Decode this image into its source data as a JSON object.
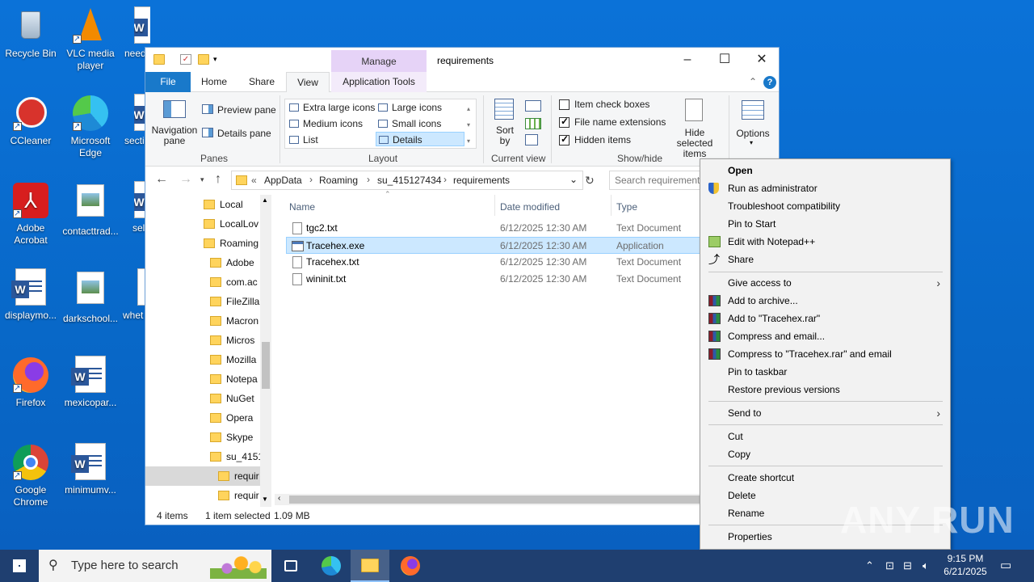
{
  "desktop": {
    "icons": [
      {
        "label": "Recycle Bin",
        "icon": "recycle-bin-icon"
      },
      {
        "label": "VLC media player",
        "icon": "vlc-icon"
      },
      {
        "label": "need",
        "icon": "word-doc-icon"
      },
      {
        "label": "CCleaner",
        "icon": "ccleaner-icon"
      },
      {
        "label": "Microsoft Edge",
        "icon": "edge-icon"
      },
      {
        "label": "secti",
        "icon": "word-doc-icon"
      },
      {
        "label": "Adobe Acrobat",
        "icon": "acrobat-icon"
      },
      {
        "label": "contacttrad...",
        "icon": "image-file-icon"
      },
      {
        "label": "sel",
        "icon": "word-doc-icon"
      },
      {
        "label": "displaymo...",
        "icon": "word-doc-icon"
      },
      {
        "label": "darkschool...",
        "icon": "image-file-icon"
      },
      {
        "label": "whet",
        "icon": "word-doc-icon"
      },
      {
        "label": "Firefox",
        "icon": "firefox-icon"
      },
      {
        "label": "mexicopar...",
        "icon": "word-doc-icon"
      },
      {
        "label": "Google Chrome",
        "icon": "chrome-icon"
      },
      {
        "label": "minimumv...",
        "icon": "word-doc-icon"
      }
    ]
  },
  "window": {
    "title": "requirements",
    "manage_label": "Manage",
    "tabs": {
      "file": "File",
      "home": "Home",
      "share": "Share",
      "view": "View",
      "app_tools": "Application Tools"
    },
    "ribbon": {
      "panes": {
        "nav_pane": "Navigation pane",
        "preview_pane": "Preview pane",
        "details_pane": "Details pane",
        "group": "Panes"
      },
      "layout": {
        "extra_large": "Extra large icons",
        "large": "Large icons",
        "medium": "Medium icons",
        "small": "Small icons",
        "list": "List",
        "details": "Details",
        "group": "Layout"
      },
      "current_view": {
        "sort_by": "Sort by",
        "group": "Current view"
      },
      "show_hide": {
        "item_check_boxes": "Item check boxes",
        "file_name_extensions": "File name extensions",
        "hidden_items": "Hidden items",
        "hide_selected": "Hide selected items",
        "group": "Show/hide"
      },
      "options": "Options"
    },
    "address": {
      "crumbs": [
        "AppData",
        "Roaming",
        "su_415127434",
        "requirements"
      ],
      "search_placeholder": "Search requirements"
    },
    "nav_pane": [
      "Local",
      "LocalLov",
      "Roaming",
      "Adobe",
      "com.ac",
      "FileZilla",
      "Macron",
      "Micros",
      "Mozilla",
      "Notepa",
      "NuGet",
      "Opera",
      "Skype",
      "su_4151",
      "requir",
      "requir"
    ],
    "columns": {
      "name": "Name",
      "date": "Date modified",
      "type": "Type"
    },
    "files": [
      {
        "name": "tgc2.txt",
        "date": "6/12/2025 12:30 AM",
        "type": "Text Document"
      },
      {
        "name": "Tracehex.exe",
        "date": "6/12/2025 12:30 AM",
        "type": "Application"
      },
      {
        "name": "Tracehex.txt",
        "date": "6/12/2025 12:30 AM",
        "type": "Text Document"
      },
      {
        "name": "wininit.txt",
        "date": "6/12/2025 12:30 AM",
        "type": "Text Document"
      }
    ],
    "status": {
      "count": "4 items",
      "selected": "1 item selected",
      "size": "1.09 MB"
    }
  },
  "context_menu": {
    "open": "Open",
    "run_as_admin": "Run as administrator",
    "troubleshoot": "Troubleshoot compatibility",
    "pin_start": "Pin to Start",
    "edit_npp": "Edit with Notepad++",
    "share": "Share",
    "give_access": "Give access to",
    "add_archive": "Add to archive...",
    "add_rar": "Add to \"Tracehex.rar\"",
    "compress_email": "Compress and email...",
    "compress_rar_email": "Compress to \"Tracehex.rar\" and email",
    "pin_taskbar": "Pin to taskbar",
    "restore": "Restore previous versions",
    "send_to": "Send to",
    "cut": "Cut",
    "copy": "Copy",
    "create_shortcut": "Create shortcut",
    "delete": "Delete",
    "rename": "Rename",
    "properties": "Properties"
  },
  "watermark": "ANY RUN",
  "taskbar": {
    "search_placeholder": "Type here to search",
    "time": "9:15 PM",
    "date": "6/21/2025"
  }
}
